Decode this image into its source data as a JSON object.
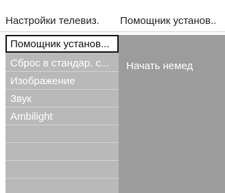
{
  "header": {
    "left_title": "Настройки телевиз.",
    "right_title": "Помощник установ.."
  },
  "menu": {
    "items": [
      {
        "label": "Помощник установ...",
        "selected": true
      },
      {
        "label": "Сброс в стандар. с...",
        "selected": false
      },
      {
        "label": "Изображение",
        "selected": false
      },
      {
        "label": "Звук",
        "selected": false
      },
      {
        "label": "Ambilight",
        "selected": false
      },
      {
        "label": "",
        "selected": false
      },
      {
        "label": "",
        "selected": false
      },
      {
        "label": "",
        "selected": false
      }
    ]
  },
  "submenu": {
    "text": "Начать немед"
  },
  "colors": {
    "menu_bg": "#b9b9b9",
    "submenu_bg": "#9c9c9c",
    "selected_bg": "#ffffff",
    "selected_border": "#111111"
  }
}
